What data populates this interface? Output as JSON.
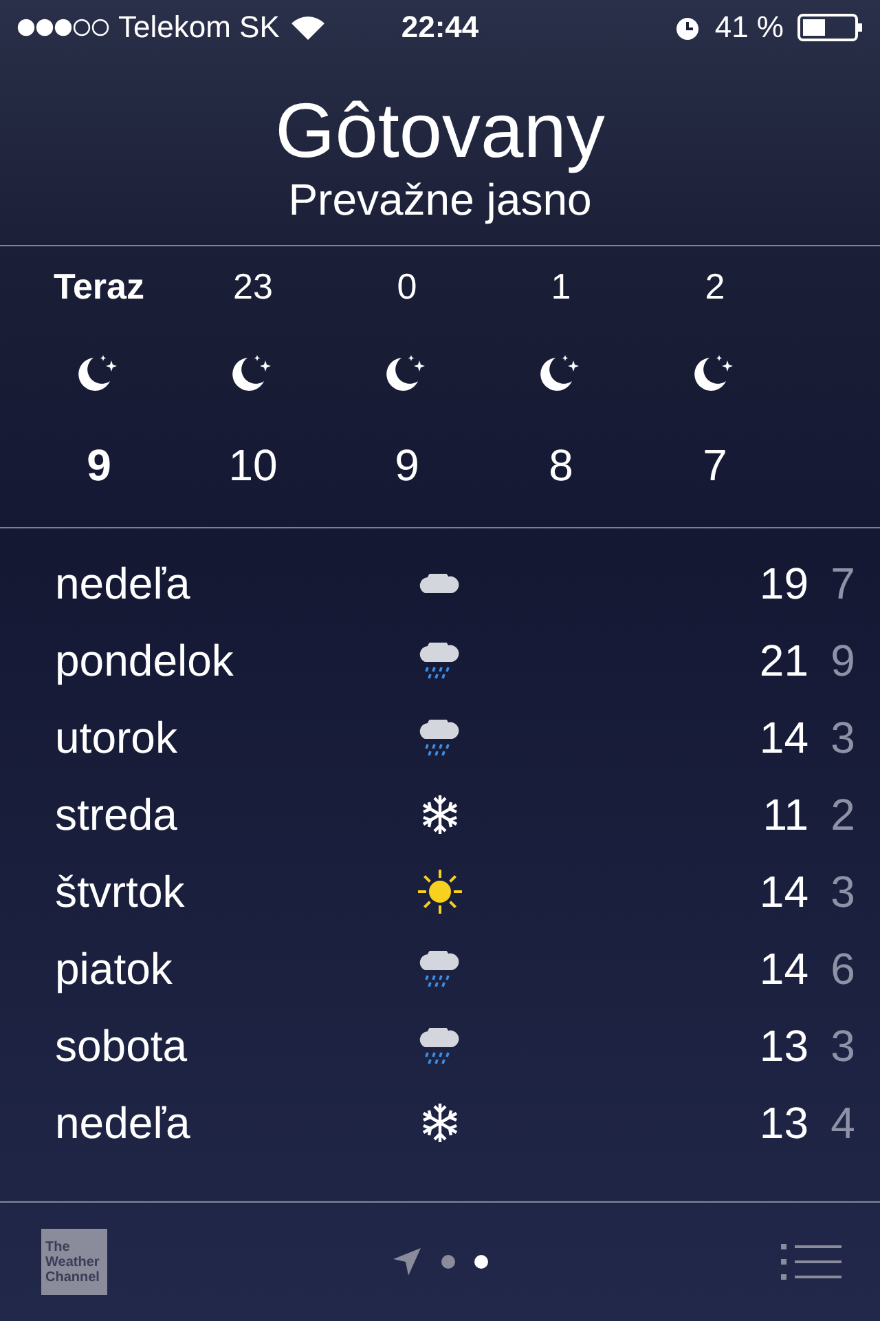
{
  "status_bar": {
    "carrier": "Telekom SK",
    "time": "22:44",
    "battery": "41 %"
  },
  "location": {
    "city": "Gôtovany",
    "condition": "Prevažne jasno"
  },
  "hourly": [
    {
      "label": "Teraz",
      "selected": true,
      "kind": "moon",
      "temp": "9"
    },
    {
      "label": "23",
      "selected": false,
      "kind": "moon",
      "temp": "10"
    },
    {
      "label": "0",
      "selected": false,
      "kind": "moon",
      "temp": "9"
    },
    {
      "label": "1",
      "selected": false,
      "kind": "moon",
      "temp": "8"
    },
    {
      "label": "2",
      "selected": false,
      "kind": "moon",
      "temp": "7"
    }
  ],
  "daily": [
    {
      "day": "nedeľa",
      "kind": "cloud",
      "high": "19",
      "low": "7"
    },
    {
      "day": "pondelok",
      "kind": "rain",
      "high": "21",
      "low": "9"
    },
    {
      "day": "utorok",
      "kind": "rain",
      "high": "14",
      "low": "3"
    },
    {
      "day": "streda",
      "kind": "snow",
      "high": "11",
      "low": "2"
    },
    {
      "day": "štvrtok",
      "kind": "sun",
      "high": "14",
      "low": "3"
    },
    {
      "day": "piatok",
      "kind": "rain",
      "high": "14",
      "low": "6"
    },
    {
      "day": "sobota",
      "kind": "rain",
      "high": "13",
      "low": "3"
    },
    {
      "day": "nedeľa",
      "kind": "snow",
      "high": "13",
      "low": "4"
    }
  ],
  "footer": {
    "logo": [
      "The",
      "Weather",
      "Channel"
    ],
    "pages": [
      {
        "kind": "location",
        "selected": false
      },
      {
        "kind": "dot",
        "selected": false
      },
      {
        "kind": "dot",
        "selected": true
      }
    ]
  }
}
